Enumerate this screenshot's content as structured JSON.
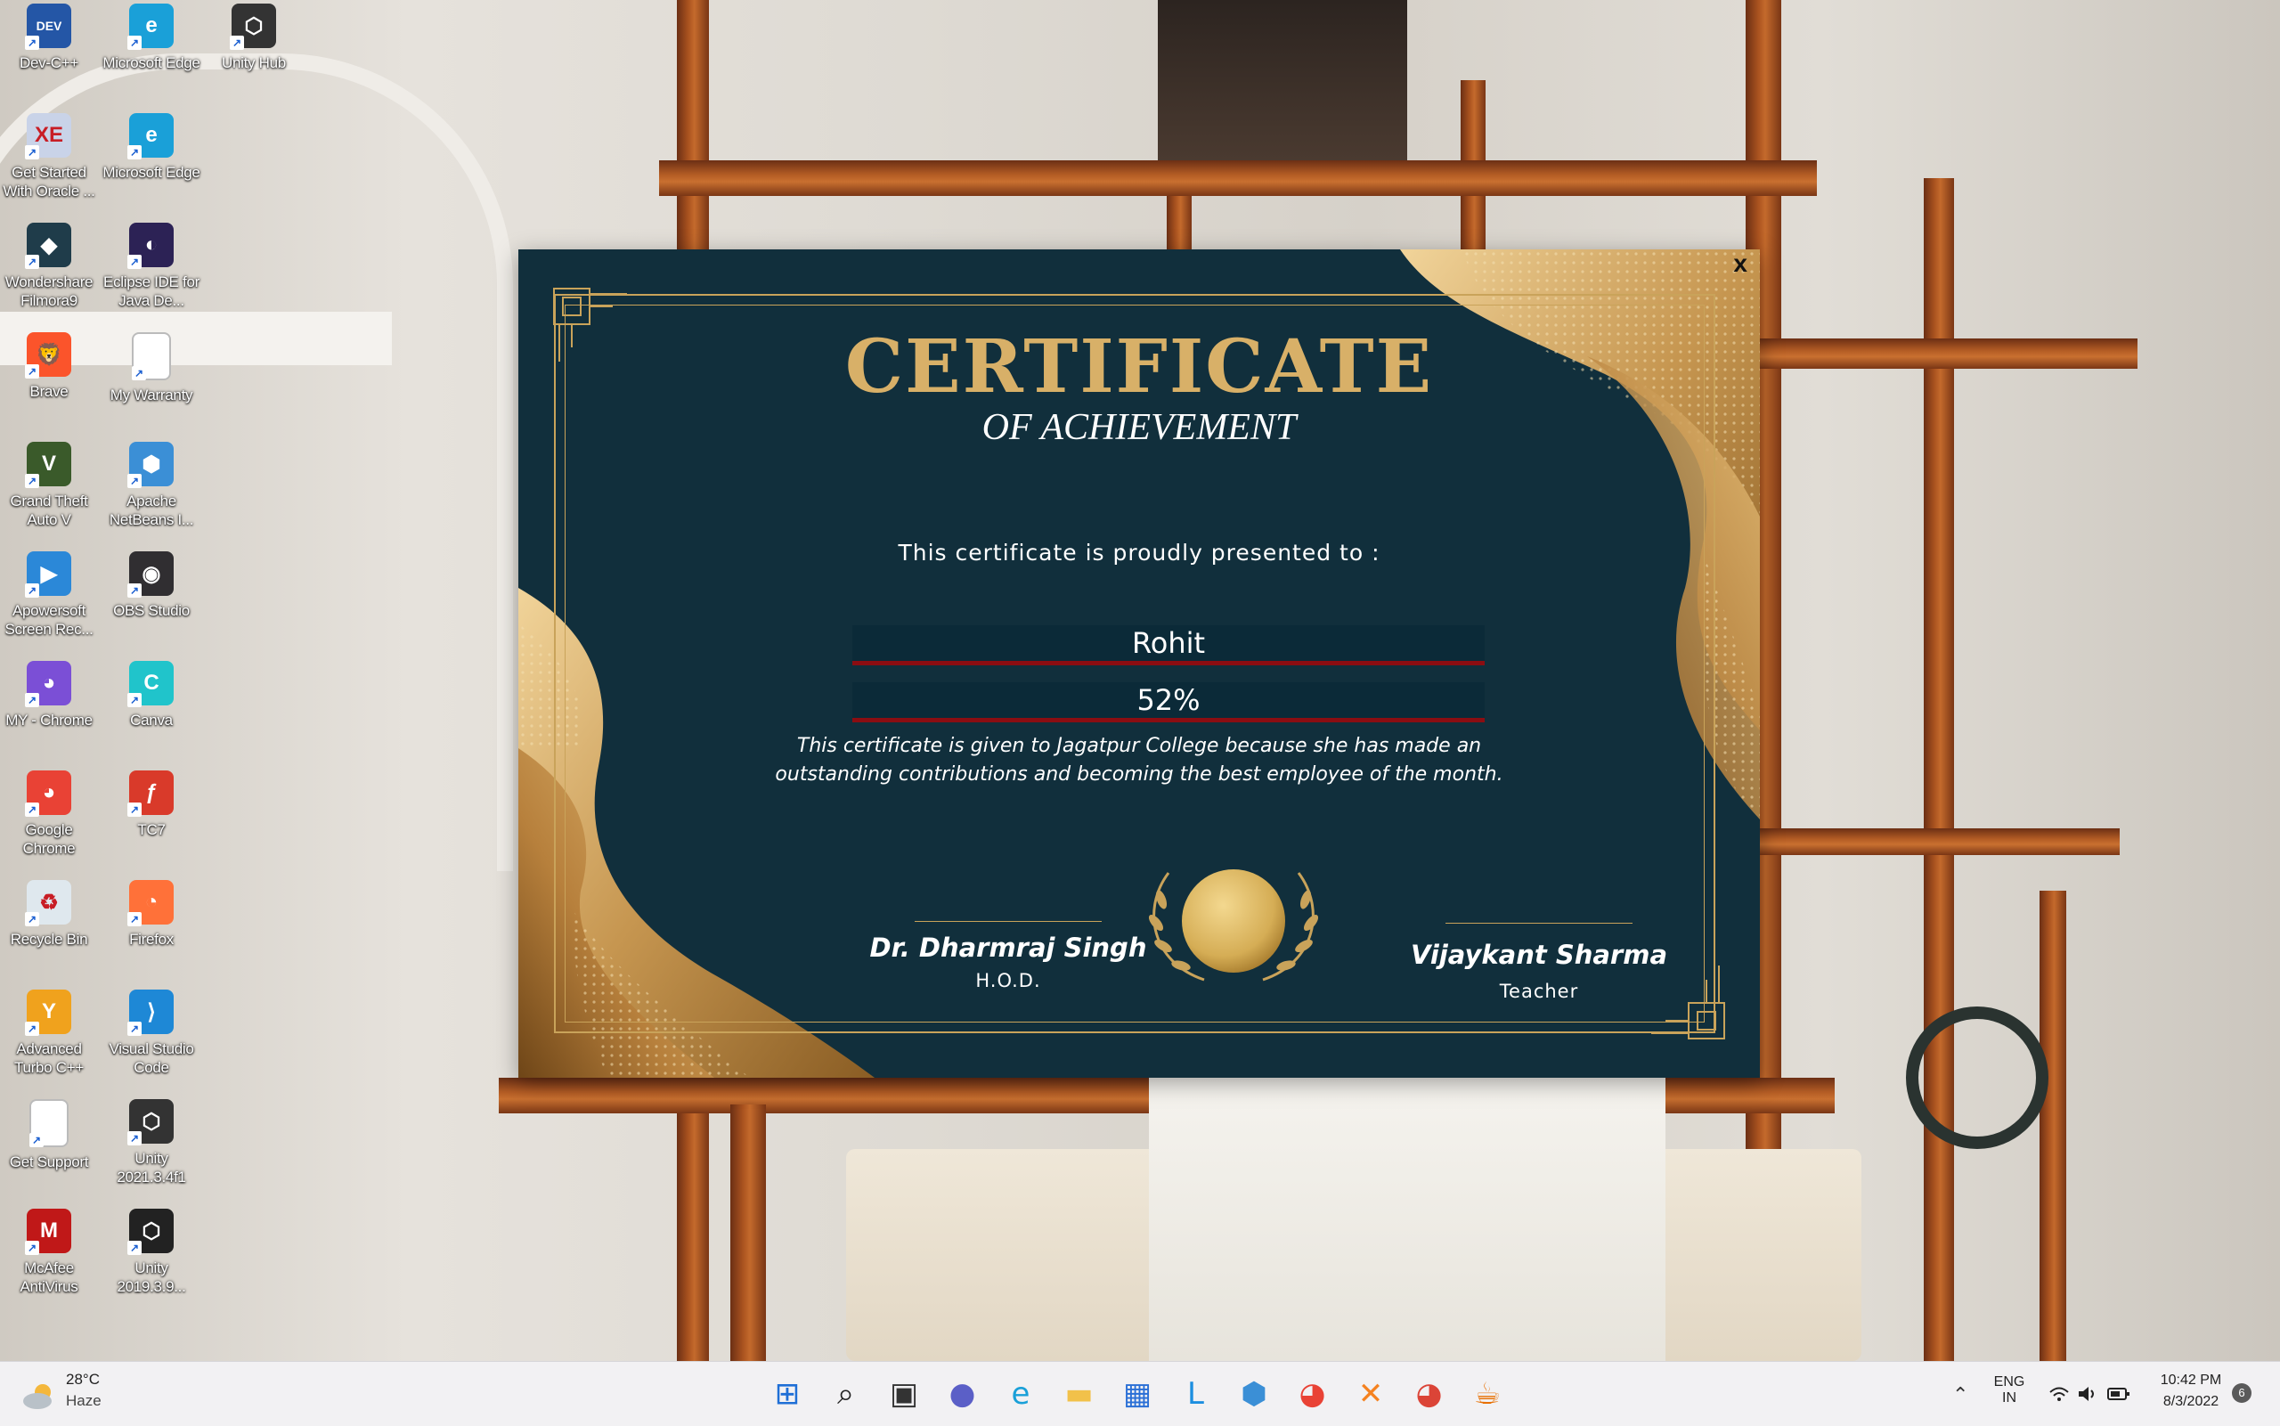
{
  "desktop": {
    "icons": [
      {
        "label": "Dev-C++",
        "icon": "devcpp-icon",
        "color": "#2456a6"
      },
      {
        "label": "Microsoft Edge",
        "icon": "edge-icon",
        "color": "#1aa0d8"
      },
      {
        "label": "Unity Hub",
        "icon": "unity-hub-icon",
        "color": "#333333"
      },
      {
        "label": "Get Started With Oracle ...",
        "icon": "oracle-icon",
        "color": "#c9d3e8"
      },
      {
        "label": "Microsoft Edge",
        "icon": "edge-icon",
        "color": "#1aa0d8"
      },
      {
        "label": "Wondershare Filmora9",
        "icon": "filmora-icon",
        "color": "#1f3c4a"
      },
      {
        "label": "Eclipse IDE for Java De...",
        "icon": "eclipse-icon",
        "color": "#2c2255"
      },
      {
        "label": "Brave",
        "icon": "brave-icon",
        "color": "#fb542b"
      },
      {
        "label": "My Warranty",
        "icon": "document-icon",
        "color": "#ffffff"
      },
      {
        "label": "Grand Theft Auto V",
        "icon": "gta-icon",
        "color": "#3a5a2a"
      },
      {
        "label": "Apache NetBeans I...",
        "icon": "netbeans-icon",
        "color": "#3b8fd6"
      },
      {
        "label": "Apowersoft Screen Rec...",
        "icon": "apowersoft-icon",
        "color": "#2b88d8"
      },
      {
        "label": "OBS Studio",
        "icon": "obs-icon",
        "color": "#302e31"
      },
      {
        "label": "MY - Chrome",
        "icon": "chrome-profile-icon",
        "color": "#7b4fd6"
      },
      {
        "label": "Canva",
        "icon": "canva-icon",
        "color": "#20c4cb"
      },
      {
        "label": "Google Chrome",
        "icon": "chrome-icon",
        "color": "#e94235"
      },
      {
        "label": "TC7",
        "icon": "tc7-icon",
        "color": "#d93a2a"
      },
      {
        "label": "Recycle Bin",
        "icon": "recycle-bin-icon",
        "color": "#dfe8ee"
      },
      {
        "label": "Firefox",
        "icon": "firefox-icon",
        "color": "#ff7139"
      },
      {
        "label": "Advanced Turbo C++",
        "icon": "turbo-cpp-icon",
        "color": "#f0a21d"
      },
      {
        "label": "Visual Studio Code",
        "icon": "vscode-icon",
        "color": "#1e88d6"
      },
      {
        "label": "Get Support",
        "icon": "document-icon",
        "color": "#ffffff"
      },
      {
        "label": "Unity 2021.3.4f1",
        "icon": "unity-icon",
        "color": "#333333"
      },
      {
        "label": "McAfee AntiVirus",
        "icon": "mcafee-icon",
        "color": "#c01818"
      },
      {
        "label": "Unity 2019.3.9...",
        "icon": "unity-icon",
        "color": "#222222"
      }
    ]
  },
  "certificate": {
    "close_label": "x",
    "title": "CERTIFICATE",
    "subtitle": "OF ACHIEVEMENT",
    "presented_to": "This certificate is proudly presented to :",
    "recipient_name": "Rohit",
    "score": "52%",
    "description_line1": "This certificate is given to Jagatpur College because she has made an",
    "description_line2": "outstanding contributions and becoming the best employee of the month.",
    "signer_left_name": "Dr. Dharmraj Singh",
    "signer_left_role": "H.O.D.",
    "signer_right_name": "Vijaykant Sharma",
    "signer_right_role": "Teacher",
    "colors": {
      "background": "#112f3c",
      "gold": "#d8b068",
      "underline": "#8b0d12"
    }
  },
  "taskbar": {
    "weather": {
      "temperature": "28°C",
      "condition": "Haze"
    },
    "apps": [
      "start-icon",
      "search-icon",
      "task-view-icon",
      "chat-icon",
      "edge-icon",
      "file-explorer-icon",
      "store-icon",
      "l-app-icon",
      "netbeans-icon",
      "chrome-icon",
      "xampp-icon",
      "chrome-profile-icon",
      "java-icon"
    ],
    "language_line1": "ENG",
    "language_line2": "IN",
    "time": "10:42 PM",
    "date": "8/3/2022",
    "notification_count": "6"
  }
}
